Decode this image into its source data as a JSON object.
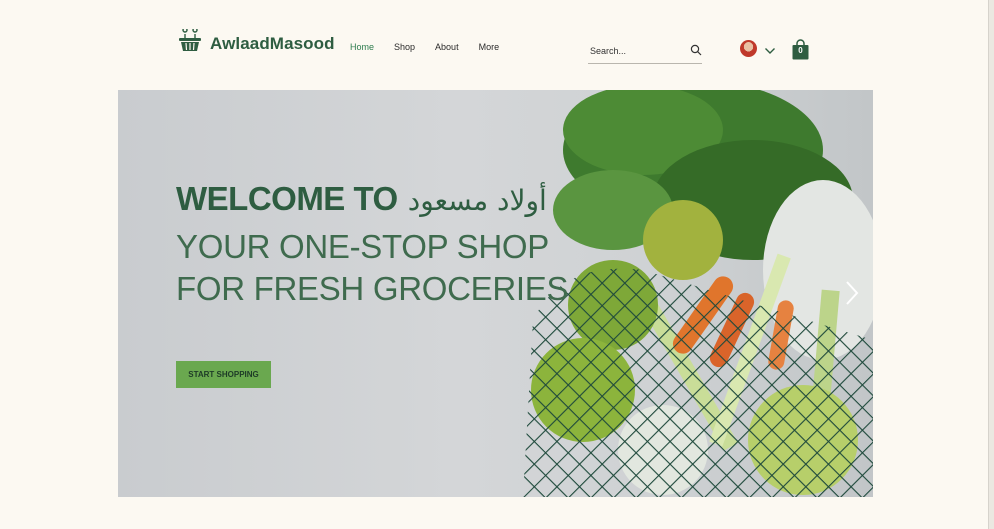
{
  "header": {
    "brand": "AwlaadMasood",
    "logo_icon": "basket-icon",
    "nav": [
      {
        "label": "Home",
        "active": true
      },
      {
        "label": "Shop",
        "active": false
      },
      {
        "label": "About",
        "active": false
      },
      {
        "label": "More",
        "active": false
      }
    ],
    "search": {
      "placeholder": "Search..."
    },
    "cart": {
      "count": "0"
    }
  },
  "hero": {
    "headline": "WELCOME TO",
    "headline_arabic": "أولاد مسعود",
    "subheadline": "YOUR ONE-STOP SHOP FOR FRESH GROCERIES",
    "cta_label": "START SHOPPING"
  },
  "colors": {
    "brand_green": "#2e5d41",
    "cta_green": "#6aa84f",
    "background": "#fcf9f2"
  }
}
